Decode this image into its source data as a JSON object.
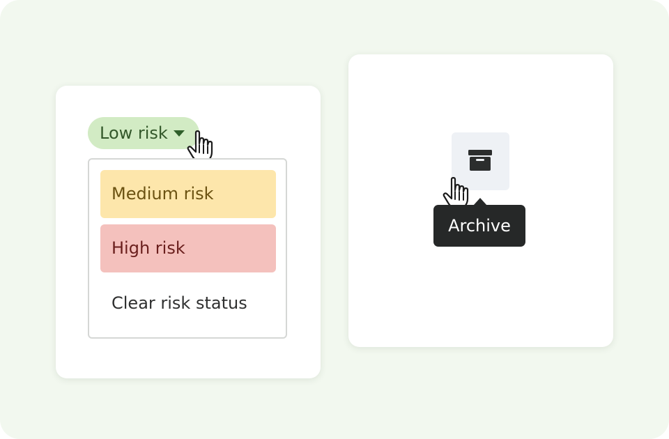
{
  "risk_selector": {
    "current_label": "Low risk",
    "options": [
      {
        "label": "Medium risk",
        "color": "#fde6ab",
        "text_color": "#6b5212"
      },
      {
        "label": "High risk",
        "color": "#f4c1bd",
        "text_color": "#6a1f1d"
      },
      {
        "label": "Clear risk status"
      }
    ],
    "current_color": "#d2ebc4",
    "current_text_color": "#33582a"
  },
  "archive": {
    "icon": "archive-box-icon",
    "tooltip": "Archive"
  },
  "cursor": "pointer-hand-icon",
  "colors": {
    "background": "#f2f8ef",
    "card": "#ffffff",
    "tooltip_bg": "#262828"
  }
}
